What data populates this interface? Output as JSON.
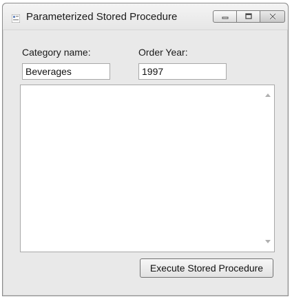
{
  "window": {
    "title": "Parameterized Stored Procedure",
    "icon": "form-icon",
    "caption_buttons": [
      "minimize-icon",
      "maximize-icon",
      "close-icon"
    ]
  },
  "form": {
    "category_label": "Category name:",
    "category_value": "Beverages",
    "year_label": "Order Year:",
    "year_value": "1997",
    "output_value": "",
    "execute_label": "Execute Stored Procedure"
  }
}
